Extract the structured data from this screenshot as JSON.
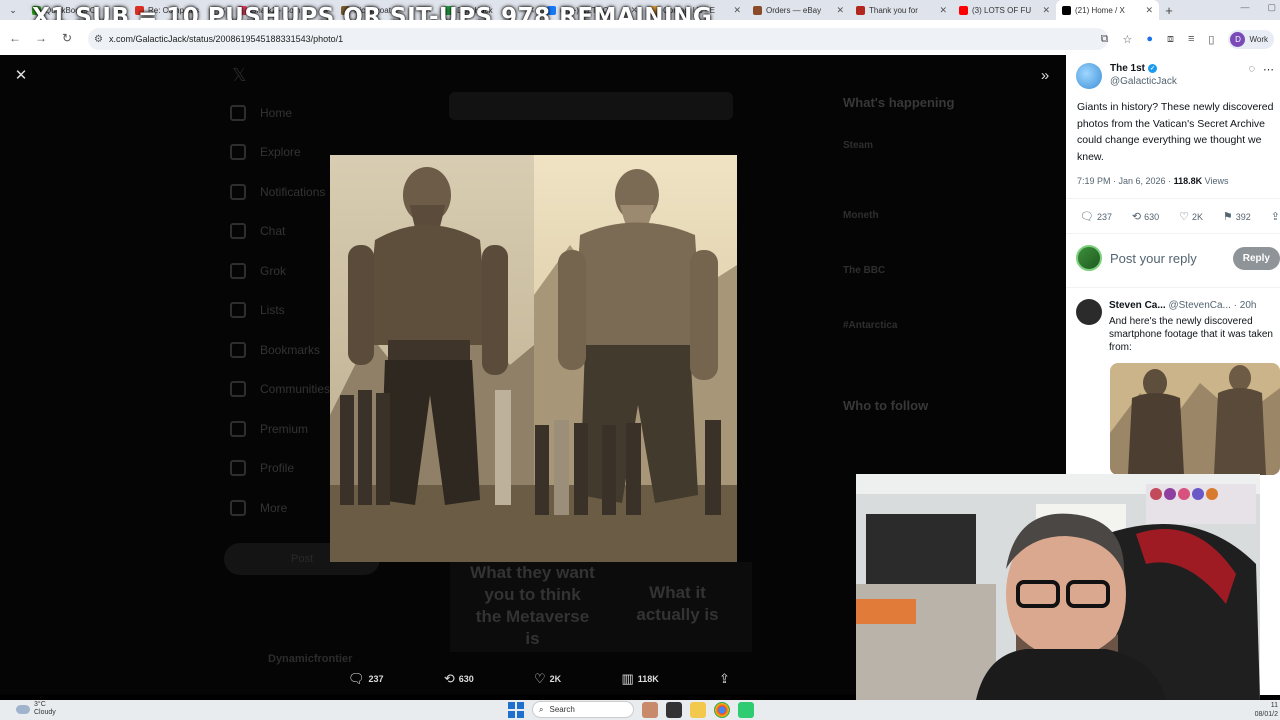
{
  "overlay_banner": "X1 SUB = 10 PUSHUPS OR SIT-UPS 978 REMAINING",
  "browser": {
    "tabs": [
      {
        "title": "QuickBooks O",
        "color": "#2ca01c"
      },
      {
        "title": "Re: Comp ans",
        "color": "#d93025"
      },
      {
        "title": "Shark2 - Com",
        "color": "#e4405f"
      },
      {
        "title": "Kickingoat",
        "color": "#7a5c2e"
      },
      {
        "title": "DoorHack",
        "color": "#25a244"
      },
      {
        "title": "(99+) CZTOC |",
        "color": "#1877f2"
      },
      {
        "title": "Contact Us - E",
        "color": "#e6a23c"
      },
      {
        "title": "Orders — eBay",
        "color": "#8a4b2a"
      },
      {
        "title": "Thank you for",
        "color": "#b3261e"
      },
      {
        "title": "(3) LOTS OF FU",
        "color": "#ff0000"
      },
      {
        "title": "(21) Home / X",
        "color": "#000000"
      }
    ],
    "active_tab_index": 10,
    "url": "x.com/GalacticJack/status/2008619545188331543/photo/1",
    "profile_label": "Work",
    "profile_initial": "D"
  },
  "background": {
    "nav_items": [
      "Home",
      "Explore",
      "Notifications",
      "Chat",
      "Grok",
      "Lists",
      "Bookmarks",
      "Communities",
      "Premium",
      "Profile",
      "More"
    ],
    "post_button": "Post",
    "whats_happening": "What's happening",
    "who_to_follow": "Who to follow",
    "meme_left": "What they want you to think the Metaverse is",
    "meme_right": "What it actually is",
    "trend_1": "Steam",
    "trend_2": "Moneth",
    "trend_3": "The BBC",
    "trend_4": "#Antarctica",
    "bottom_user": "Dynamicfrontier"
  },
  "photo_actions": {
    "replies": "237",
    "reposts": "630",
    "likes": "2K",
    "views": "118K"
  },
  "tweet": {
    "author_name": "The 1st",
    "author_handle": "@GalacticJack",
    "text": "Giants in history? These newly discovered photos from the Vatican's Secret Archive could change everything we thought we knew.",
    "time": "7:19 PM · Jan 6, 2026 ·",
    "views_count": "118.8K",
    "views_label": "Views",
    "replies": "237",
    "reposts": "630",
    "likes": "2K",
    "bookmarks": "392",
    "reply_placeholder": "Post your reply",
    "reply_button": "Reply"
  },
  "reply": {
    "name": "Steven Ca...",
    "handle": "@StevenCa...",
    "age": "· 20h",
    "text": "And here's the newly discovered smartphone footage that it was taken from:"
  },
  "taskbar": {
    "temp": "3°C",
    "weather": "Cloudy",
    "search": "Search",
    "time": "11",
    "date": "08/01/2"
  }
}
